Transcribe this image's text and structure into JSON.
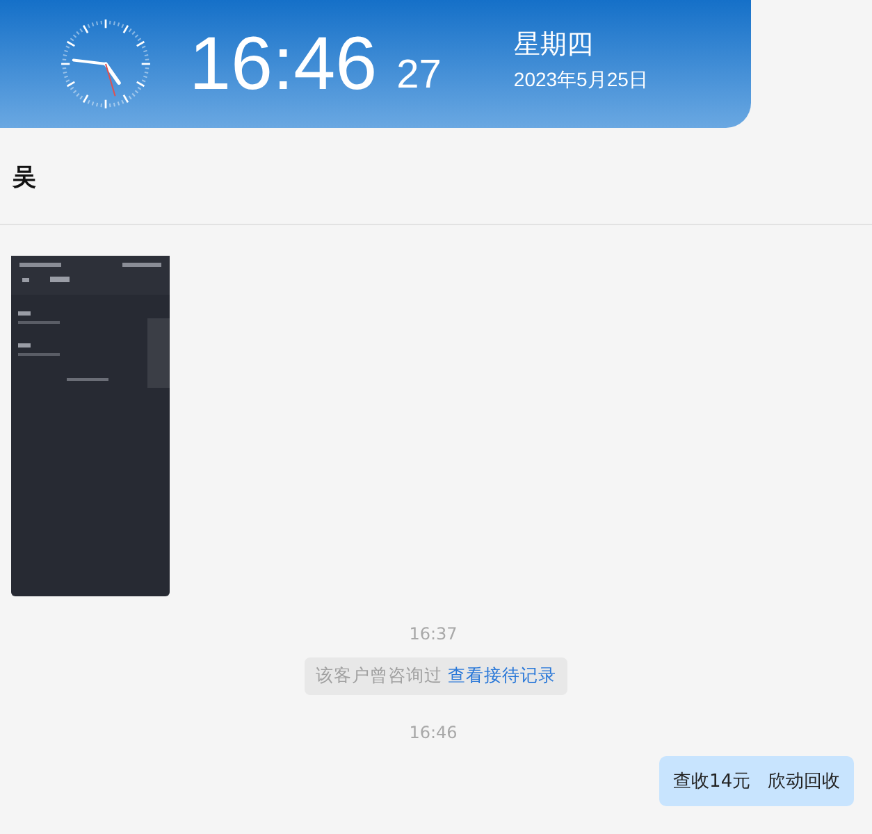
{
  "clock": {
    "time": "16:46",
    "seconds": "27",
    "weekday": "星期四",
    "date": "2023年5月25日"
  },
  "chat": {
    "contact_name": "吴",
    "messages": [
      {
        "kind": "picture"
      },
      {
        "kind": "time",
        "text": "16:37"
      },
      {
        "kind": "notice",
        "text": "该客户曾咨询过",
        "link": "查看接待记录"
      },
      {
        "kind": "time",
        "text": "16:46"
      },
      {
        "kind": "outgoing",
        "text": "查收14元   欣动回收"
      }
    ]
  }
}
